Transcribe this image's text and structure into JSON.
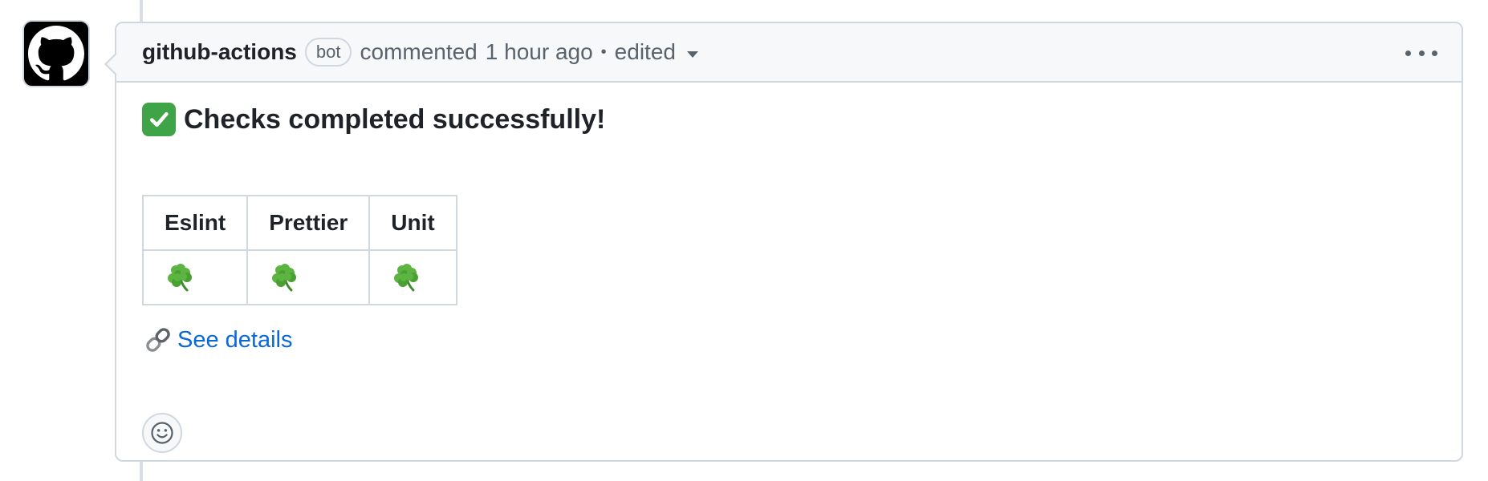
{
  "comment": {
    "author": "github-actions",
    "badge": "bot",
    "action": "commented",
    "time": "1 hour ago",
    "separator": "•",
    "edited_label": "edited"
  },
  "body": {
    "heading": "Checks completed successfully!",
    "table": {
      "headers": [
        "Eslint",
        "Prettier",
        "Unit"
      ],
      "rows": [
        [
          {
            "icon": "shamrock-icon",
            "status": "pass"
          },
          {
            "icon": "shamrock-icon",
            "status": "pass"
          },
          {
            "icon": "shamrock-icon",
            "status": "pass"
          }
        ]
      ]
    },
    "details_link": "See details"
  },
  "icons": {
    "avatar": "github-octocat-icon",
    "heading": "white-check-mark-icon",
    "link": "link-icon",
    "reaction": "smiley-icon",
    "more": "kebab-horizontal-icon",
    "edited_menu": "triangle-down-icon"
  },
  "colors": {
    "link": "#0969da",
    "border": "#d0d7de",
    "header_bg": "#f6f8fa",
    "muted_text": "#59636e",
    "check_green": "#3fa447"
  }
}
